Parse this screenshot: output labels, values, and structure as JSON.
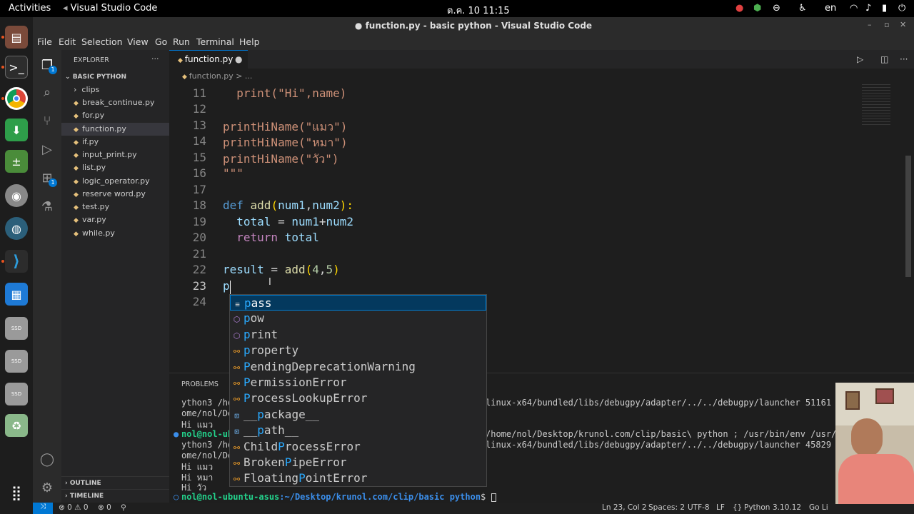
{
  "topbar": {
    "activities": "Activities",
    "app": "Visual Studio Code",
    "clock": "ต.ค. 10  11:15",
    "lang": "en"
  },
  "window": {
    "title": "● function.py - basic python - Visual Studio Code"
  },
  "menu": [
    "File",
    "Edit",
    "Selection",
    "View",
    "Go",
    "Run",
    "Terminal",
    "Help"
  ],
  "sidebar": {
    "header": "EXPLORER",
    "folder": "BASIC PYTHON",
    "items": [
      "clips",
      "break_continue.py",
      "for.py",
      "function.py",
      "if.py",
      "input_print.py",
      "list.py",
      "logic_operator.py",
      "reserve word.py",
      "test.py",
      "var.py",
      "while.py"
    ],
    "outline": "OUTLINE",
    "timeline": "TIMELINE"
  },
  "activity_badges": {
    "explorer": "1",
    "extensions": "1"
  },
  "editor": {
    "tab": "function.py",
    "breadcrumb": "function.py > ...",
    "line_numbers": [
      "11",
      "12",
      "13",
      "14",
      "15",
      "16",
      "17",
      "18",
      "19",
      "20",
      "21",
      "22",
      "23",
      "24"
    ],
    "lines": {
      "l11": "  print(\"Hi\",name)",
      "l13": "printHiName(\"แมว\")",
      "l14": "printHiName(\"หมา\")",
      "l15": "printHiName(\"วัว\")",
      "l16": "\"\"\"",
      "l18a": "def ",
      "l18b": "add",
      "l18c": "(",
      "l18d": "num1",
      "l18e": ",",
      "l18f": "num2",
      "l18g": "):",
      "l19a": "  total",
      "l19b": " = ",
      "l19c": "num1",
      "l19d": "+",
      "l19e": "num2",
      "l20a": "  return ",
      "l20b": "total",
      "l22a": "result",
      "l22b": " = ",
      "l22c": "add",
      "l22d": "(",
      "l22e": "4",
      "l22f": ",",
      "l22g": "5",
      "l22h": ")",
      "l23": "p"
    }
  },
  "suggestions": [
    {
      "pre": "p",
      "rest": "ass",
      "kind": "keyword"
    },
    {
      "pre": "p",
      "rest": "ow",
      "kind": "function"
    },
    {
      "pre": "p",
      "rest": "rint",
      "kind": "function"
    },
    {
      "pre": "p",
      "rest": "roperty",
      "kind": "class"
    },
    {
      "pre": "P",
      "rest": "endingDeprecationWarning",
      "kind": "class"
    },
    {
      "pre": "P",
      "rest": "ermissionError",
      "kind": "class"
    },
    {
      "pre": "P",
      "rest": "rocessLookupError",
      "kind": "class"
    },
    {
      "pre": "__",
      "mid": "p",
      "rest": "ackage__",
      "kind": "variable"
    },
    {
      "pre": "__",
      "mid": "p",
      "rest": "ath__",
      "kind": "variable"
    },
    {
      "pre": "Child",
      "mid": "P",
      "rest": "rocessError",
      "kind": "class"
    },
    {
      "pre": "Broken",
      "mid": "P",
      "rest": "ipeError",
      "kind": "class"
    },
    {
      "pre": "Floating",
      "mid": "P",
      "rest": "ointError",
      "kind": "class"
    }
  ],
  "panel": {
    "title": "PROBLEMS",
    "lines": [
      "ython3 /hom",
      "ome/nol/De",
      "Hi แมว",
      "nol@nol-ubu",
      "ython3 /hom",
      "ome/nol/De",
      "Hi แมว",
      "Hi หมา",
      "Hi วัว"
    ],
    "right_lines": [
      "linux-x64/bundled/libs/debugpy/adapter/../../debugpy/launcher 51161 -- /h",
      "/home/nol/Desktop/krunol.com/clip/basic\\ python ; /usr/bin/env /usr/bin/p",
      "linux-x64/bundled/libs/debugpy/adapter/../../debugpy/launcher 45829 -- /h"
    ],
    "prompt_user": "nol@nol-ubuntu-asus",
    "prompt_path": ":~/Desktop/krunol.com/clip/basic python",
    "prompt_end": "$ "
  },
  "statusbar": {
    "errors": "⊗ 0 ⚠ 0",
    "ports": "⊗ 0",
    "pos": "Ln 23, Col 2",
    "spaces": "Spaces: 2",
    "enc": "UTF-8",
    "eol": "LF",
    "lang": "Python",
    "ver": "3.10.12",
    "golive": "Go Li"
  }
}
